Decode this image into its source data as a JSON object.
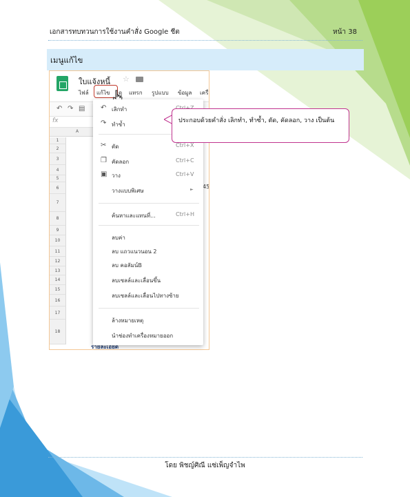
{
  "header": {
    "title": "เอกสารทบทวนการใช้งานคำสั่ง Google ชีต",
    "page_label": "หน้า 38"
  },
  "section": {
    "title": "เมนูแก้ไข"
  },
  "screenshot": {
    "doc_title": "ใบแจ้งหนี้",
    "menubar": [
      "ไฟล์",
      "แก้ไข",
      "ดู",
      "แทรก",
      "รูปแบบ",
      "ข้อมูล",
      "เครื่อง"
    ],
    "column_label": "A",
    "fx_label": "fx",
    "rows": [
      "1",
      "2",
      "3",
      "4",
      "5",
      "6",
      "7",
      "8",
      "9",
      "10",
      "11",
      "12",
      "13",
      "14",
      "15",
      "16",
      "17",
      "18"
    ],
    "edit_menu": [
      {
        "icon": "undo-icon",
        "label": "เลิกทำ",
        "shortcut": "Ctrl+Z"
      },
      {
        "icon": "redo-icon",
        "label": "ทำซ้ำ",
        "shortcut": "Ctrl+Y"
      },
      {
        "icon": "cut-icon",
        "label": "ตัด",
        "shortcut": "Ctrl+X"
      },
      {
        "icon": "copy-icon",
        "label": "คัดลอก",
        "shortcut": "Ctrl+C"
      },
      {
        "icon": "paste-icon",
        "label": "วาง",
        "shortcut": "Ctrl+V"
      },
      {
        "icon": "",
        "label": "วางแบบพิเศษ",
        "shortcut": ""
      },
      {
        "icon": "",
        "label": "ค้นหาและแทนที่...",
        "shortcut": "Ctrl+H"
      },
      {
        "icon": "",
        "label": "ลบค่า",
        "shortcut": ""
      },
      {
        "icon": "",
        "label": "ลบ แถวแนวนอน 2",
        "shortcut": ""
      },
      {
        "icon": "",
        "label": "ลบ คอลัมน์B",
        "shortcut": ""
      },
      {
        "icon": "",
        "label": "ลบเซลล์และเลื่อนขึ้น",
        "shortcut": ""
      },
      {
        "icon": "",
        "label": "ลบเซลล์และเลื่อนไปทางซ้าย",
        "shortcut": ""
      },
      {
        "icon": "",
        "label": "ล้างหมายเหตุ",
        "shortcut": ""
      },
      {
        "icon": "",
        "label": "นำช่องทำเครื่องหมายออก",
        "shortcut": ""
      }
    ],
    "sheet_cells": [
      "45",
      "รายละเอียด"
    ]
  },
  "callout": {
    "text": "ประกอบด้วยคำสั่ง เลิกทำ, ทำซ้ำ, ตัด, คัดลอก, วาง เป็นต้น"
  },
  "footer": {
    "text": "โดย พิชญ์ศิณี แซ่เพ็ญจำไพ"
  },
  "colors": {
    "section_bg": "#d6ecfa",
    "decor_green": "#9ccf59",
    "decor_blue": "#3a9ad9",
    "callout_border": "#c0338f",
    "screenshot_border": "#f4c795"
  }
}
